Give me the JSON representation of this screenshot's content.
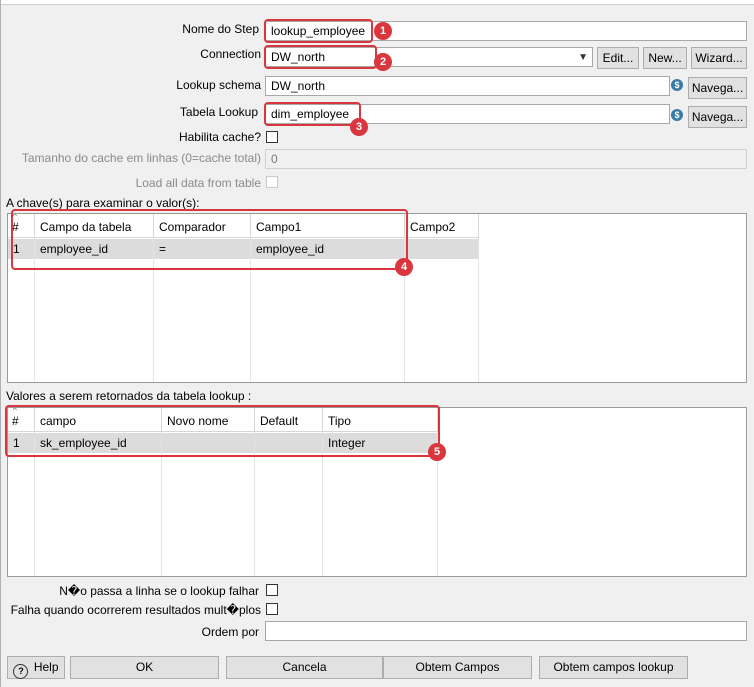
{
  "form": {
    "step_name_label": "Nome do Step",
    "step_name_value": "lookup_employee",
    "connection_label": "Connection",
    "connection_value": "DW_north",
    "edit_button": "Edit...",
    "new_button": "New...",
    "wizard_button": "Wizard...",
    "lookup_schema_label": "Lookup schema",
    "lookup_schema_value": "DW_north",
    "browse_button": "Navega...",
    "table_label": "Tabela Lookup",
    "table_value": "dim_employee",
    "cache_label": "Habilita cache?",
    "cache_size_label": "Tamanho do cache em linhas (0=cache total)",
    "cache_size_value": "0",
    "load_all_label": "Load all data from table"
  },
  "keys": {
    "section_label": "A chave(s) para examinar o valor(s):",
    "columns": [
      "#",
      "Campo da tabela",
      "Comparador",
      "Campo1",
      "Campo2"
    ],
    "rows": [
      [
        "1",
        "employee_id",
        "=",
        "employee_id",
        ""
      ]
    ]
  },
  "values": {
    "section_label": "Valores a serem retornados da tabela lookup :",
    "columns": [
      "#",
      "campo",
      "Novo nome",
      "Default",
      "Tipo"
    ],
    "rows": [
      [
        "1",
        "sk_employee_id",
        "",
        "",
        "Integer"
      ]
    ]
  },
  "options": {
    "no_pass_label": "N�o passa a linha se o lookup falhar",
    "fail_multiple_label": "Falha quando ocorrerem resultados mult�plos",
    "order_label": "Ordem por",
    "order_value": ""
  },
  "footer": {
    "help_button": "Help",
    "ok_button": "OK",
    "cancel_button": "Cancela",
    "get_fields_button": "Obtem Campos",
    "get_lookup_fields_button": "Obtem campos lookup"
  },
  "callouts": [
    "1",
    "2",
    "3",
    "4",
    "5"
  ],
  "accent_color": "#d9363e"
}
